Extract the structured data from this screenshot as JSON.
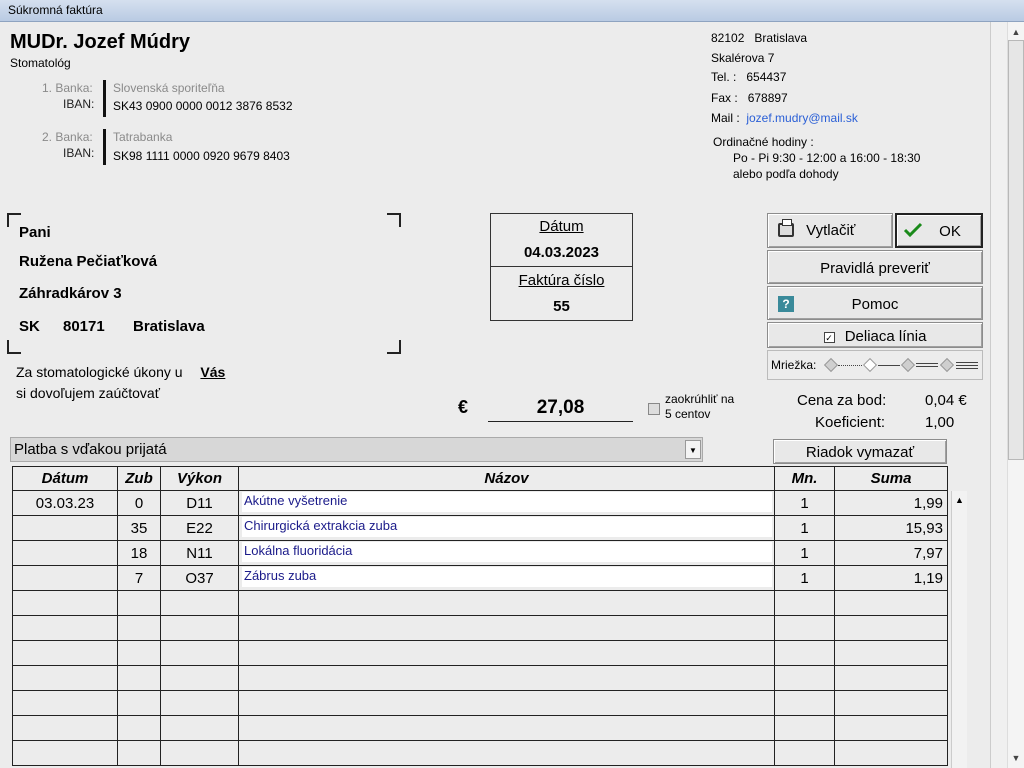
{
  "window": {
    "title": "Súkromná faktúra"
  },
  "doctor": {
    "name": "MUDr. Jozef Múdry",
    "specialty": "Stomatológ",
    "banks": [
      {
        "label_bank": "1. Banka:",
        "bank_name": "Slovenská sporiteľňa",
        "label_iban": "IBAN:",
        "iban": "SK43 0900 0000 0012 3876 8532"
      },
      {
        "label_bank": "2. Banka:",
        "bank_name": "Tatrabanka",
        "label_iban": "IBAN:",
        "iban": "SK98 1111 0000 0920 9679 8403"
      }
    ]
  },
  "contact": {
    "postcode": "82102",
    "city": "Bratislava",
    "street": "Skalérova 7",
    "tel_label": "Tel. :",
    "tel": "654437",
    "fax_label": "Fax :",
    "fax": "678897",
    "mail_label": "Mail :",
    "mail": "jozef.mudry@mail.sk",
    "hours_title": "Ordinačné hodiny :",
    "hours_line1": "Po - Pi  9:30 - 12:00 a 16:00 - 18:30",
    "hours_line2": "alebo podľa dohody"
  },
  "recipient": {
    "salutation": "Pani",
    "name": "Ružena Pečiaťková",
    "street": "Záhradkárov 3",
    "country": "SK",
    "postcode": "80171",
    "city": "Bratislava"
  },
  "intro": {
    "line1": "Za stomatologické úkony u",
    "emph": "Vás",
    "line2": "si dovoľujem zaúčtovať"
  },
  "invoice": {
    "date_label": "Dátum",
    "date": "04.03.2023",
    "number_label": "Faktúra číslo",
    "number": "55"
  },
  "total": {
    "currency": "€",
    "amount": "27,08",
    "round_label_1": "zaokrúhliť na",
    "round_label_2": "5 centov"
  },
  "buttons": {
    "print": "Vytlačiť",
    "ok": "OK",
    "rules": "Pravidlá preveriť",
    "help": "Pomoc",
    "help_icon": "?",
    "divider": "Deliaca línia",
    "delete_row": "Riadok vymazať"
  },
  "grid_option": {
    "label": "Mriežka:"
  },
  "pricing": {
    "point_label": "Cena za bod:",
    "point_value": "0,04 €",
    "coef_label": "Koeficient:",
    "coef_value": "1,00"
  },
  "payment": {
    "selected": "Platba s vďakou prijatá"
  },
  "table": {
    "headers": {
      "date": "Dátum",
      "tooth": "Zub",
      "code": "Výkon",
      "name": "Názov",
      "qty": "Mn.",
      "sum": "Suma"
    },
    "rows": [
      {
        "date": "03.03.23",
        "tooth": "0",
        "code": "D11",
        "name": "Akútne vyšetrenie",
        "qty": "1",
        "sum": "1,99"
      },
      {
        "date": "",
        "tooth": "35",
        "code": "E22",
        "name": "Chirurgická extrakcia zuba",
        "qty": "1",
        "sum": "15,93"
      },
      {
        "date": "",
        "tooth": "18",
        "code": "N11",
        "name": "Lokálna fluoridácia",
        "qty": "1",
        "sum": "7,97"
      },
      {
        "date": "",
        "tooth": "7",
        "code": "O37",
        "name": "Zábrus zuba",
        "qty": "1",
        "sum": "1,19"
      }
    ]
  },
  "icons": {
    "print": "printer-icon",
    "ok": "checkmark-icon",
    "help": "help-icon",
    "dropdown": "chevron-down-icon"
  }
}
